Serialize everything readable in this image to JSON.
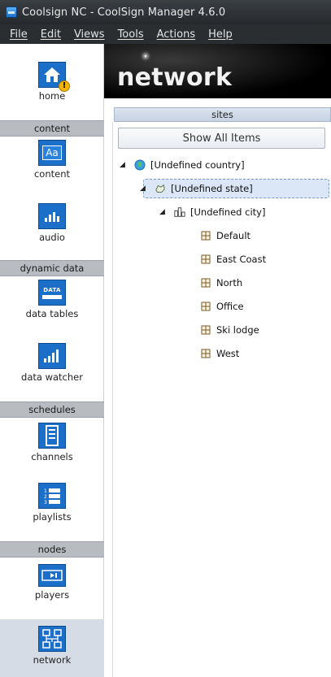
{
  "window": {
    "title": "Coolsign NC - CoolSign Manager 4.6.0"
  },
  "menu": [
    "File",
    "Edit",
    "Views",
    "Tools",
    "Actions",
    "Help"
  ],
  "sidebar": {
    "home_label": "home",
    "sections": {
      "content": "content",
      "dynamic_data": "dynamic data",
      "schedules": "schedules",
      "nodes": "nodes"
    },
    "items": {
      "content": "content",
      "audio": "audio",
      "data_tables": "data tables",
      "data_tables_icon_text": "DATA",
      "data_watcher": "data watcher",
      "channels": "channels",
      "playlists": "playlists",
      "players": "players",
      "network": "network"
    },
    "content_icon_text": "Aa"
  },
  "header": {
    "title": "network"
  },
  "sites": {
    "label": "sites",
    "show_all": "Show All Items",
    "tree": {
      "country": "[Undefined country]",
      "state": "[Undefined state]",
      "city": "[Undefined city]",
      "sites": [
        "Default",
        "East Coast",
        "North",
        "Office",
        "Ski lodge",
        "West"
      ]
    }
  },
  "colors": {
    "accent": "#1c6fc8",
    "selection": "#dbe7f6",
    "section_bar": "#b8bcc1"
  }
}
